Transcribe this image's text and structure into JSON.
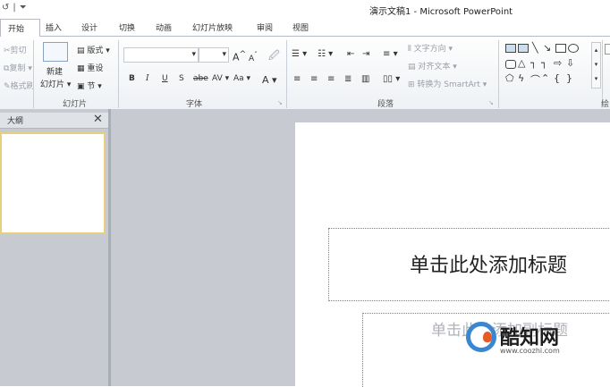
{
  "window": {
    "title": "演示文稿1 - Microsoft PowerPoint"
  },
  "tabs": [
    "开始",
    "插入",
    "设计",
    "切换",
    "动画",
    "幻灯片放映",
    "审阅",
    "视图"
  ],
  "ribbon": {
    "clipboard": {
      "cut": "剪切",
      "copy": "复制",
      "format_painter": "格式刷"
    },
    "slides": {
      "new_slide_top": "新建",
      "new_slide_bottom": "幻灯片",
      "layout": "版式",
      "reset": "重设",
      "section": "节",
      "group_label": "幻灯片"
    },
    "font": {
      "group_label": "字体",
      "bold": "B",
      "italic": "I",
      "underline": "U",
      "strike": "S",
      "shadow": "abe",
      "spacing": "AV",
      "case": "Aa",
      "grow": "A",
      "shrink": "A",
      "color": "A"
    },
    "paragraph": {
      "group_label": "段落",
      "text_direction": "文字方向",
      "align_text": "对齐文本",
      "smartart": "转换为 SmartArt"
    },
    "drawing": {
      "group_label": "绘"
    }
  },
  "left_pane": {
    "outline_tab": "大纲",
    "close": "✕"
  },
  "slide": {
    "title_placeholder": "单击此处添加标题",
    "subtitle_placeholder": "单击此处添加副标题"
  },
  "watermark": {
    "name": "酷知网",
    "url": "www.coozhi.com"
  },
  "colors": {
    "ribbon_bg": "#eef1f5",
    "canvas_bg": "#c7cbd1",
    "thumb_border": "#e8cf7a"
  }
}
